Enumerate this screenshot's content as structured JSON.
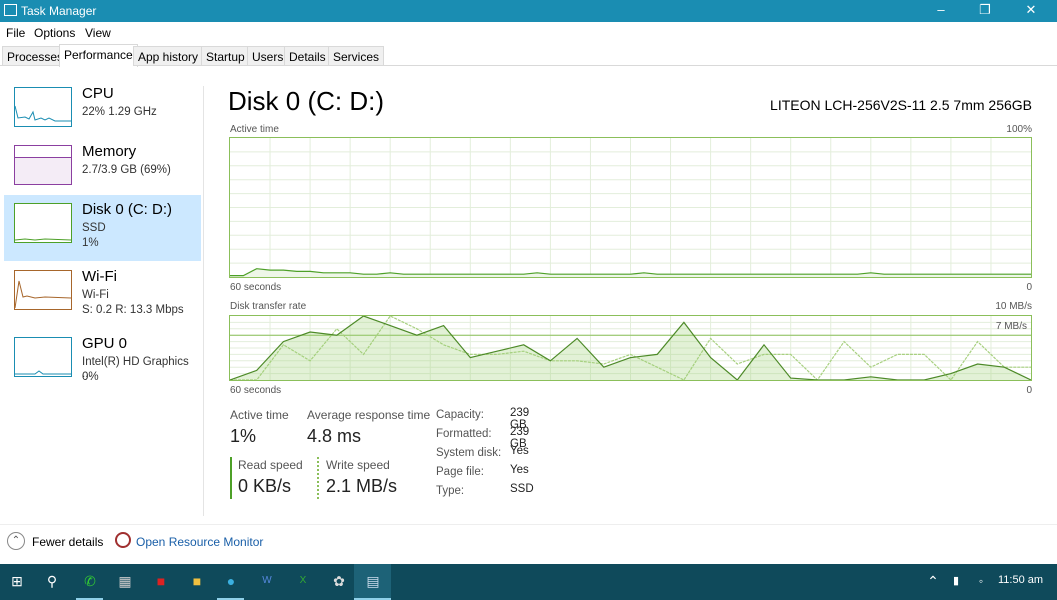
{
  "window": {
    "title": "Task Manager",
    "controls": [
      "minimize",
      "restore",
      "close"
    ]
  },
  "menu": [
    "File",
    "Options",
    "View"
  ],
  "tabs": [
    "Processes",
    "Performance",
    "App history",
    "Startup",
    "Users",
    "Details",
    "Services"
  ],
  "active_tab": "Performance",
  "sidebar": [
    {
      "title": "CPU",
      "line1": "22%  1.29 GHz",
      "color": "#1a8db2"
    },
    {
      "title": "Memory",
      "line1": "2.7/3.9 GB (69%)",
      "color": "#8b3fa0"
    },
    {
      "title": "Disk 0 (C: D:)",
      "line1": "SSD",
      "line2": "1%",
      "color": "#4da028",
      "selected": true
    },
    {
      "title": "Wi-Fi",
      "line1": "Wi-Fi",
      "line2": "S: 0.2  R: 13.3 Mbps",
      "color": "#a7662b"
    },
    {
      "title": "GPU 0",
      "line1": "Intel(R) HD Graphics ...",
      "line2": "0%",
      "color": "#1a8db2"
    }
  ],
  "main": {
    "title": "Disk 0 (C: D:)",
    "model": "LITEON LCH-256V2S-11 2.5 7mm 256GB",
    "active_graph": {
      "label": "Active time",
      "max": "100%",
      "time": "60 seconds",
      "min": "0",
      "values": [
        1,
        1,
        6,
        5,
        5,
        4,
        4,
        3,
        3,
        3,
        2,
        2,
        3,
        2,
        2,
        2,
        2,
        2,
        2,
        2,
        2,
        2,
        2,
        3,
        2,
        2,
        2,
        2,
        2,
        2,
        2,
        3,
        2,
        2,
        2,
        2,
        2,
        2,
        2,
        2,
        2,
        2,
        2,
        2,
        2,
        2,
        2,
        2,
        3,
        2,
        2,
        2,
        2,
        2,
        2,
        2,
        2,
        2,
        2,
        2,
        2
      ]
    },
    "transfer_graph": {
      "label": "Disk transfer rate",
      "max": "10 MB/s",
      "line": "7 MB/s",
      "time": "60 seconds",
      "min": "0",
      "read": [
        0,
        1.5,
        6,
        7.5,
        7,
        10,
        8.5,
        7,
        8.5,
        3.5,
        4.5,
        5.5,
        3,
        6.5,
        2,
        3.5,
        4,
        9,
        3.5,
        0,
        5.5,
        0.3,
        0,
        0,
        0.5,
        0,
        0,
        1,
        2.5,
        2,
        0
      ],
      "write": [
        0,
        0,
        5.5,
        3,
        8,
        4,
        10,
        8,
        5.5,
        4,
        4,
        4.5,
        3,
        3,
        2.5,
        4,
        2,
        0,
        6.5,
        2.5,
        4,
        4,
        0,
        6,
        2,
        4,
        4,
        0,
        6,
        2,
        2
      ]
    },
    "stats": {
      "active_time_label": "Active time",
      "active_time": "1%",
      "avg_resp_label": "Average response time",
      "avg_resp": "4.8 ms",
      "read_label": "Read speed",
      "read": "0 KB/s",
      "write_label": "Write speed",
      "write": "2.1 MB/s"
    },
    "props": [
      [
        "Capacity:",
        "239 GB"
      ],
      [
        "Formatted:",
        "239 GB"
      ],
      [
        "System disk:",
        "Yes"
      ],
      [
        "Page file:",
        "Yes"
      ],
      [
        "Type:",
        "SSD"
      ]
    ]
  },
  "footer": {
    "fewer": "Fewer details",
    "monitor": "Open Resource Monitor"
  },
  "taskbar": {
    "apps": [
      "start",
      "search",
      "whatsapp",
      "calculator",
      "acrobat",
      "file-explorer",
      "edge",
      "word",
      "excel",
      "paint",
      "task-manager"
    ],
    "time": "11:50 am"
  }
}
